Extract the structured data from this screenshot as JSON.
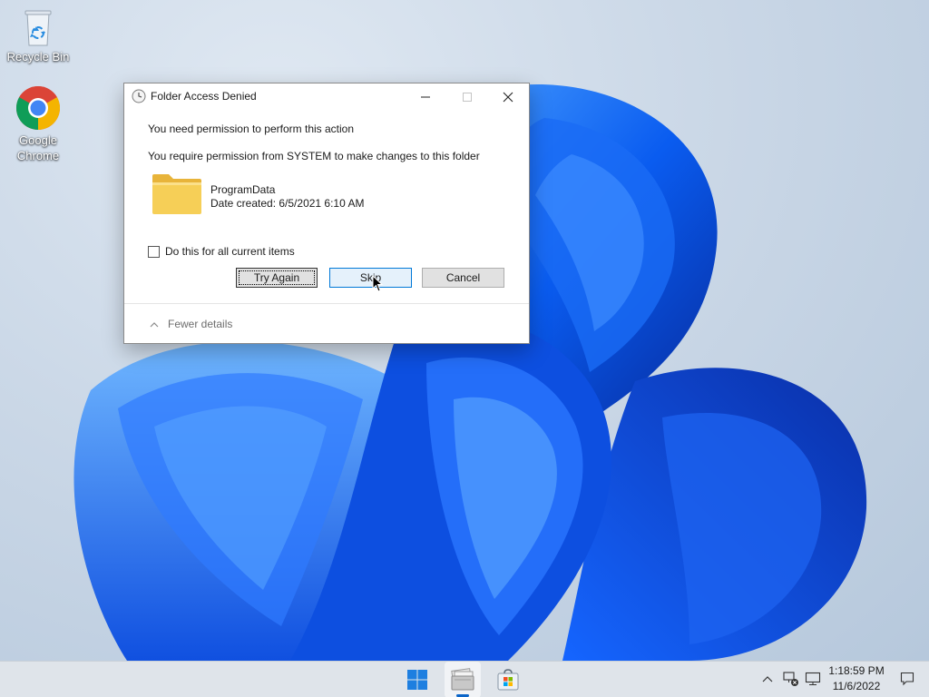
{
  "desktop": {
    "icons": [
      {
        "label": "Recycle Bin",
        "icon": "recycle-bin-icon"
      },
      {
        "label": "Google\nChrome",
        "icon": "chrome-icon"
      }
    ]
  },
  "dialog": {
    "title": "Folder Access Denied",
    "message": "You need permission to perform this action",
    "detail": "You require permission from SYSTEM to make changes to this folder",
    "item": {
      "name": "ProgramData",
      "date": "Date created: 6/5/2021 6:10 AM",
      "icon": "folder-icon"
    },
    "checkbox_label": "Do this for all current items",
    "checkbox_checked": false,
    "buttons": {
      "try_again": "Try Again",
      "skip": "Skip",
      "cancel": "Cancel"
    },
    "fewer_details": "Fewer details"
  },
  "taskbar": {
    "apps": [
      "start-icon",
      "file-explorer-icon",
      "microsoft-store-icon"
    ],
    "clock": {
      "time": "1:18:59 PM",
      "date": "11/6/2022"
    }
  },
  "colors": {
    "accent": "#0078d7",
    "folder": "#f6cf57",
    "taskbar": "#dfe4ea"
  }
}
